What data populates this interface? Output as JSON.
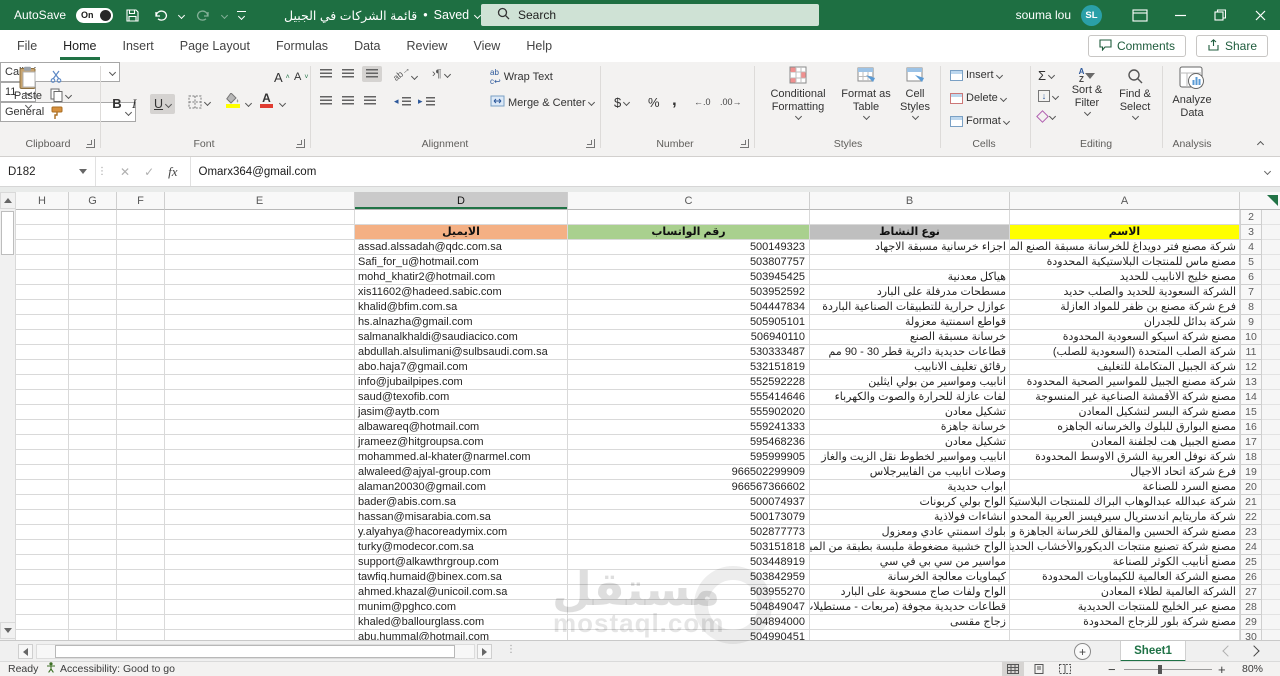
{
  "titlebar": {
    "autosave_label": "AutoSave",
    "autosave_state": "On",
    "doc_title": "قائمة الشركات في الجبيل",
    "separator": "•",
    "save_status": "Saved",
    "search_placeholder": "Search",
    "user_name": "souma lou",
    "user_initials": "SL"
  },
  "ribbon_tabs": {
    "items": [
      {
        "label": "File",
        "active": false
      },
      {
        "label": "Home",
        "active": true
      },
      {
        "label": "Insert",
        "active": false
      },
      {
        "label": "Page Layout",
        "active": false
      },
      {
        "label": "Formulas",
        "active": false
      },
      {
        "label": "Data",
        "active": false
      },
      {
        "label": "Review",
        "active": false
      },
      {
        "label": "View",
        "active": false
      },
      {
        "label": "Help",
        "active": false
      }
    ],
    "comments_label": "Comments",
    "share_label": "Share"
  },
  "ribbon": {
    "clipboard": {
      "group_label": "Clipboard",
      "paste_label": "Paste"
    },
    "font": {
      "group_label": "Font",
      "font_name": "Calibri",
      "font_size": "11",
      "bold": "B",
      "italic": "I",
      "underline": "U"
    },
    "alignment": {
      "group_label": "Alignment",
      "wrap_text_label": "Wrap Text",
      "merge_center_label": "Merge & Center",
      "paragraph_mark": "¶"
    },
    "number": {
      "group_label": "Number",
      "number_format": "General",
      "currency": "$",
      "percent": "%",
      "comma": ",",
      "inc_decimal": "←.0",
      "dec_decimal": ".00→"
    },
    "styles": {
      "group_label": "Styles",
      "conditional_formatting_label": "Conditional Formatting",
      "format_as_table_label": "Format as Table",
      "cell_styles_label": "Cell Styles"
    },
    "cells": {
      "group_label": "Cells",
      "insert_label": "Insert",
      "delete_label": "Delete",
      "format_label": "Format"
    },
    "editing": {
      "group_label": "Editing",
      "autosum": "Σ",
      "sort_filter_label": "Sort & Filter",
      "find_select_label": "Find & Select",
      "az": "AZ"
    },
    "analysis": {
      "group_label": "Analysis",
      "analyze_data_label": "Analyze Data"
    }
  },
  "formula_bar": {
    "name_box": "D182",
    "fx_label": "fx",
    "value": "Omarx364@gmail.com"
  },
  "grid": {
    "visible_columns": [
      "H",
      "G",
      "F",
      "E",
      "D",
      "C",
      "B",
      "A"
    ],
    "selected_column": "D",
    "header_fills": {
      "name": "#ffff00",
      "activity": "#bfbfbf",
      "whatsapp": "#a9d08e",
      "email": "#f4b084"
    },
    "rows": [
      {
        "row": 2,
        "name": "",
        "activity": "",
        "whatsapp": "",
        "email": ""
      },
      {
        "row": 3,
        "header": true,
        "name": "الاسم",
        "activity": "نوع النشاط",
        "whatsapp": "رقم الواتساب",
        "email": "الايميل"
      },
      {
        "row": 4,
        "name": "شركة مصنع فتر دويداغ للخرسانة مسبقة الصنع المحدودة",
        "activity": "اجزاء خرسانية مسبقة الاجهاد",
        "whatsapp": "500149323",
        "email": "assad.alssadah@qdc.com.sa"
      },
      {
        "row": 5,
        "name": "مصنع ماس للمنتجات البلاستيكية المحدودة",
        "activity": "",
        "whatsapp": "503807757",
        "email": "Safi_for_u@hotmail.com"
      },
      {
        "row": 6,
        "name": "مصنع خليج الانابيب للحديد",
        "activity": "هياكل معدنية",
        "whatsapp": "503945425",
        "email": "mohd_khatir2@hotmail.com"
      },
      {
        "row": 7,
        "name": "الشركة السعودية للحديد والصلب حديد",
        "activity": "مسطحات مدرفلة على البارد",
        "whatsapp": "503952592",
        "email": "xis11602@hadeed.sabic.com"
      },
      {
        "row": 8,
        "name": "فرع شركة مصنع بن ظفر للمواد العازلة",
        "activity": "عوازل حرارية للتطبيقات الصناعية الباردة",
        "whatsapp": "504447834",
        "email": "khalid@bfim.com.sa"
      },
      {
        "row": 9,
        "name": "شركة بدائل للجدران",
        "activity": "قواطع اسمنتية معزولة",
        "whatsapp": "505905101",
        "email": "hs.alnazha@gmail.com"
      },
      {
        "row": 10,
        "name": "مصنع شركة اسيكو السعودية المحدودة",
        "activity": "خرسانة مسبقة الصنع",
        "whatsapp": "506940110",
        "email": "salmanalkhaldi@saudiacico.com"
      },
      {
        "row": 11,
        "name": "شركة الصلب المتحدة (السعودية للصلب)",
        "activity": "قطاعات حديدية دائرية قطر 30 - 90 مم",
        "whatsapp": "530333487",
        "email": "abdullah.alsulimani@sulbsaudi.com.sa"
      },
      {
        "row": 12,
        "name": "شركة الجبيل المتكاملة للتغليف",
        "activity": "رقائق تغليف الانابيب",
        "whatsapp": "532151819",
        "email": "abo.haja7@gmail.com"
      },
      {
        "row": 13,
        "name": "شركة مصنع الجبيل للمواسير الصحية المحدودة",
        "activity": "انابيب ومواسير من بولي ايثلين",
        "whatsapp": "552592228",
        "email": "info@jubailpipes.com"
      },
      {
        "row": 14,
        "name": "مصنع شركة الأقمشة الصناعية غير المنسوجة",
        "activity": "لفات عازلة للحرارة والصوت والكهرباء",
        "whatsapp": "555414646",
        "email": "saud@texofib.com"
      },
      {
        "row": 15,
        "name": "مصنع شركة البسر لتشكيل المعادن",
        "activity": "تشكيل معادن",
        "whatsapp": "555902020",
        "email": "jasim@aytb.com"
      },
      {
        "row": 16,
        "name": "مصنع البوارق للبلوك والخرسانه الجاهزه",
        "activity": "خرسانة جاهزة",
        "whatsapp": "559241333",
        "email": "albawareq@hotmail.com"
      },
      {
        "row": 17,
        "name": "مصنع الجبيل هت لجلفنة المعادن",
        "activity": "تشكيل معادن",
        "whatsapp": "595468236",
        "email": "jrameez@hitgroupsa.com"
      },
      {
        "row": 18,
        "name": "شركة نوفل العربية الشرق الاوسط المحدودة",
        "activity": "انابيب ومواسير لخطوط نقل الزيت والغاز",
        "whatsapp": "595999905",
        "email": "mohammed.al-khater@narmel.com"
      },
      {
        "row": 19,
        "name": "فرع شركة اتحاد الاجيال",
        "activity": "وصلات انابيب من الفايبرجلاس",
        "whatsapp": "966502299909",
        "email": "alwaleed@ajyal-group.com"
      },
      {
        "row": 20,
        "name": "مصنع السرد للصناعة",
        "activity": "ابواب حديدية",
        "whatsapp": "966567366602",
        "email": "alaman20030@gmail.com"
      },
      {
        "row": 21,
        "name": "شركة عبدالله عبدالوهاب البراك للمنتجات البلاستيكية",
        "activity": "الواح بولي كربونات",
        "whatsapp": "500074937",
        "email": "bader@abis.com.sa"
      },
      {
        "row": 22,
        "name": "شركة ماريتايم اندستريال سيرفيسز العربية المحدودة",
        "activity": "انشاءات فولاذية",
        "whatsapp": "500173079",
        "email": "hassan@misarabia.com.sa"
      },
      {
        "row": 23,
        "name": "مصنع شركة الحسين والمقالق للخرسانة الجاهزة والبلك الأسمنتي",
        "activity": "بلوك اسمنتي عادي ومعزول",
        "whatsapp": "502877773",
        "email": "y.alyahya@hacoreadymix.com"
      },
      {
        "row": 24,
        "name": "مصنع شركة تصنيع منتجات الديكوروالأخشاب الحديثة",
        "activity": "الواح خشبية مضغوطة ملبسة بطبقة من الميلامين او ال",
        "whatsapp": "503151818",
        "email": "turky@modecor.com.sa"
      },
      {
        "row": 25,
        "name": "مصنع أنابيب الكوثر للصناعة",
        "activity": "مواسير من سي بي في سي",
        "whatsapp": "503448919",
        "email": "support@alkawthrgroup.com"
      },
      {
        "row": 26,
        "name": "مصنع الشركة العالمية للكيماويات المحدودة",
        "activity": "كيماويات معالجة الخرسانة",
        "whatsapp": "503842959",
        "email": "tawfiq.humaid@binex.com.sa"
      },
      {
        "row": 27,
        "name": "الشركة العالمية لطلاء المعادن",
        "activity": "الواح ولفات صاج مسحوبة على البارد",
        "whatsapp": "503955270",
        "email": "ahmed.khazal@unicoil.com.sa"
      },
      {
        "row": 28,
        "name": "مصنع عبر الخليج للمنتجات الحديدية",
        "activity": "قطاعات حديدية مجوفة (مربعات - مستطيلات)",
        "whatsapp": "504849047",
        "email": "munim@pghco.com"
      },
      {
        "row": 29,
        "name": "مصنع شركة بلور للزجاج المحدودة",
        "activity": "زجاج مقسى",
        "whatsapp": "504894000",
        "email": "khaled@ballourglass.com"
      },
      {
        "row": 30,
        "name": "",
        "activity": "",
        "whatsapp": "504990451",
        "email": "abu.hummal@hotmail.com"
      }
    ]
  },
  "watermark": {
    "text": "مستقل",
    "domain": "mostaql.com"
  },
  "sheet_bar": {
    "sheet_name": "Sheet1",
    "add_sheet": "+"
  },
  "status_bar": {
    "ready_label": "Ready",
    "accessibility_label": "Accessibility: Good to go",
    "zoom_level": "80%"
  },
  "colors": {
    "titlebar_green": "#1e6f42",
    "accent_green": "#217346",
    "name_fill": "#ffff00",
    "activity_fill": "#bfbfbf",
    "whatsapp_fill": "#a9d08e",
    "email_fill": "#f4b084",
    "avatar_teal": "#2aa0a8"
  }
}
